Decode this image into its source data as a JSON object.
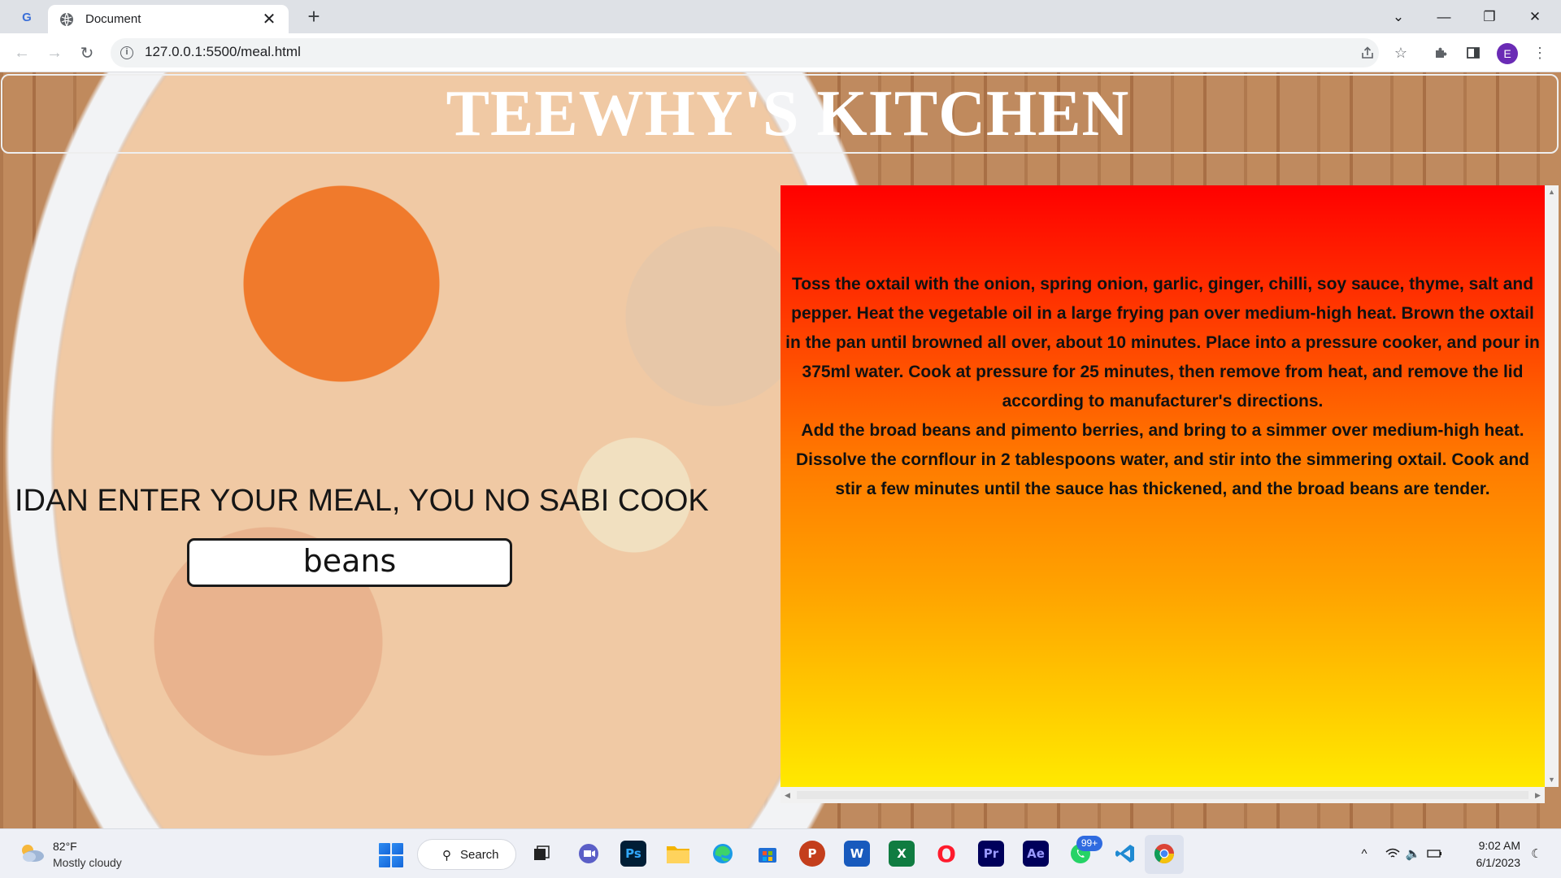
{
  "browser": {
    "tab_title": "Document",
    "tab_close": "✕",
    "new_tab": "+",
    "url": "127.0.0.1:5500/meal.html",
    "profile_initial": "E",
    "window_controls": {
      "dropdown": "⌄",
      "minimize": "—",
      "restore": "❐",
      "close": "✕"
    },
    "nav": {
      "back": "←",
      "forward": "→",
      "reload": "↻"
    },
    "icons": {
      "share": "share-icon",
      "bookmark": "star-icon",
      "extensions": "puzzle-icon",
      "sidepanel": "sidepanel-icon",
      "menu": "kebab-menu-icon"
    }
  },
  "page": {
    "site_title": "TEEWHY'S KITCHEN",
    "prompt": "IDAN ENTER YOUR MEAL, YOU NO SABI COOK",
    "meal_input_value": "beans",
    "recipe_paragraphs": [
      "Toss the oxtail with the onion, spring onion, garlic, ginger, chilli, soy sauce, thyme, salt and pepper. Heat the vegetable oil in a large frying pan over medium-high heat. Brown the oxtail in the pan until browned all over, about 10 minutes. Place into a pressure cooker, and pour in 375ml water. Cook at pressure for 25 minutes, then remove from heat, and remove the lid according to manufacturer's directions.",
      "Add the broad beans and pimento berries, and bring to a simmer over medium-high heat. Dissolve the cornflour in 2 tablespoons water, and stir into the simmering oxtail. Cook and stir a few minutes until the sauce has thickened, and the broad beans are tender."
    ],
    "panel_gradient": [
      "#ff0000",
      "#ff7b00",
      "#ffa200",
      "#ffef00"
    ]
  },
  "taskbar": {
    "weather_temp": "82°F",
    "weather_desc": "Mostly cloudy",
    "search_label": "Search",
    "whatsapp_badge": "99+",
    "clock_time": "9:02 AM",
    "clock_date": "6/1/2023",
    "apps": [
      {
        "name": "task-view-icon",
        "label": ""
      },
      {
        "name": "teams-chat-icon",
        "label": ""
      },
      {
        "name": "photoshop-icon",
        "label": "Ps",
        "color": "#001e36",
        "fg": "#31a8ff"
      },
      {
        "name": "file-explorer-icon",
        "label": ""
      },
      {
        "name": "edge-icon",
        "label": ""
      },
      {
        "name": "microsoft-store-icon",
        "label": ""
      },
      {
        "name": "powerpoint-icon",
        "label": "P",
        "color": "#c43e1c"
      },
      {
        "name": "word-icon",
        "label": "W",
        "color": "#185abd"
      },
      {
        "name": "excel-icon",
        "label": "X",
        "color": "#107c41"
      },
      {
        "name": "opera-icon",
        "label": "O",
        "color": "#ff1b2d"
      },
      {
        "name": "premiere-icon",
        "label": "Pr",
        "color": "#00005b",
        "fg": "#9999ff"
      },
      {
        "name": "after-effects-icon",
        "label": "Ae",
        "color": "#00005b",
        "fg": "#9999ff"
      },
      {
        "name": "whatsapp-icon",
        "label": ""
      },
      {
        "name": "vscode-icon",
        "label": ""
      },
      {
        "name": "chrome-icon",
        "label": ""
      }
    ]
  }
}
